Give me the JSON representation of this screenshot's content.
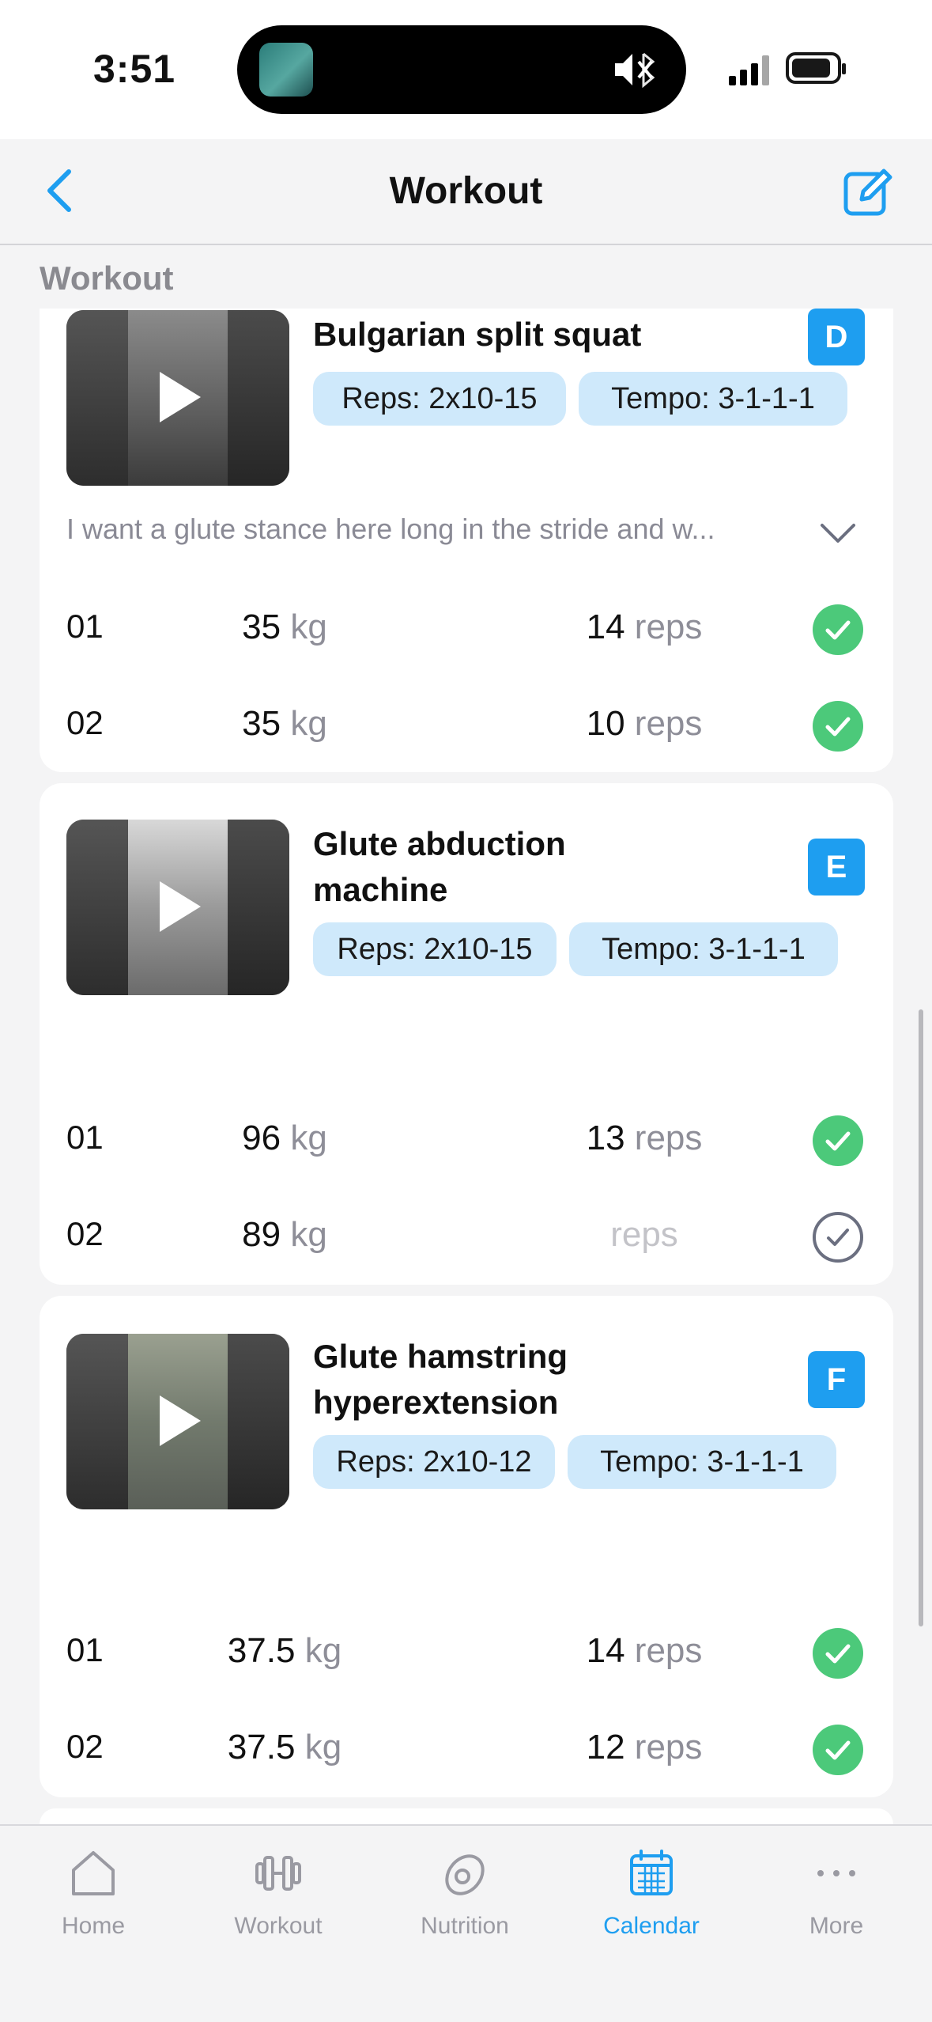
{
  "status_bar": {
    "time": "3:51"
  },
  "nav": {
    "title": "Workout"
  },
  "section": {
    "title": "Workout"
  },
  "exercises": [
    {
      "name": "Bulgarian split squat",
      "badge": "D",
      "reps": "Reps: 2x10-15",
      "tempo": "Tempo: 3-1-1-1",
      "note": "I want a glute stance here long in the stride and w...",
      "sets": [
        {
          "num": "01",
          "kg": "35",
          "kg_unit": "kg",
          "reps": "14",
          "reps_unit": "reps",
          "done": true
        },
        {
          "num": "02",
          "kg": "35",
          "kg_unit": "kg",
          "reps": "10",
          "reps_unit": "reps",
          "done": true
        }
      ]
    },
    {
      "name": "Glute abduction machine",
      "badge": "E",
      "reps": "Reps: 2x10-15",
      "tempo": "Tempo: 3-1-1-1",
      "sets": [
        {
          "num": "01",
          "kg": "96",
          "kg_unit": "kg",
          "reps": "13",
          "reps_unit": "reps",
          "done": true
        },
        {
          "num": "02",
          "kg": "89",
          "kg_unit": "kg",
          "reps": "",
          "reps_unit": "reps",
          "done": false
        }
      ]
    },
    {
      "name": "Glute hamstring hyperextension",
      "badge": "F",
      "reps": "Reps: 2x10-12",
      "tempo": "Tempo: 3-1-1-1",
      "sets": [
        {
          "num": "01",
          "kg": "37.5",
          "kg_unit": "kg",
          "reps": "14",
          "reps_unit": "reps",
          "done": true
        },
        {
          "num": "02",
          "kg": "37.5",
          "kg_unit": "kg",
          "reps": "12",
          "reps_unit": "reps",
          "done": true
        }
      ]
    }
  ],
  "tabs": [
    {
      "label": "Home",
      "icon": "home-icon",
      "active": false
    },
    {
      "label": "Workout",
      "icon": "dumbbell-icon",
      "active": false
    },
    {
      "label": "Nutrition",
      "icon": "avocado-icon",
      "active": false
    },
    {
      "label": "Calendar",
      "icon": "calendar-icon",
      "active": true
    },
    {
      "label": "More",
      "icon": "more-icon",
      "active": false
    }
  ],
  "colors": {
    "accent": "#1e9ef0",
    "done": "#4cc97a",
    "chip": "#cfe9fb"
  }
}
